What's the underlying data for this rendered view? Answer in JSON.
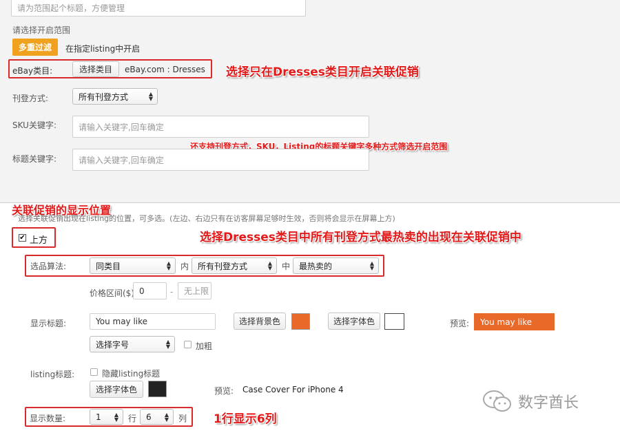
{
  "scope": {
    "title_placeholder": "请为范围起个标题，方便管理",
    "section_label": "请选择开启范围",
    "filter_button": "多重过滤",
    "filter_hint": "在指定listing中开启",
    "ebay_category_label": "eBay类目:",
    "choose_category_button": "选择类目",
    "selected_category": "eBay.com : Dresses",
    "listing_type_label": "刊登方式:",
    "listing_type_value": "所有刊登方式",
    "sku_label": "SKU关键字:",
    "sku_placeholder": "请输入关键字,回车确定",
    "title_keyword_label": "标题关键字:",
    "title_keyword_placeholder": "请输入关键字,回车确定"
  },
  "display": {
    "hint": "选择关联促销出现在listing的位置，可多选。(左边、右边只有在访客屏幕足够时生效，否则将会显示在屏幕上方)",
    "top_option": "上方",
    "algorithm_label": "选品算法:",
    "algorithm_value": "同类目",
    "in_text": "内",
    "listing_type_value": "所有刊登方式",
    "middle_text": "中",
    "sort_value": "最热卖的",
    "price_label": "价格区间($):",
    "price_min": "0",
    "price_sep": "-",
    "price_max_placeholder": "无上限",
    "show_title_label": "显示标题:",
    "show_title_value": "You may like",
    "bg_color_button": "选择背景色",
    "font_color_button": "选择字体色",
    "preview_label": "预览:",
    "preview_text": "You may like",
    "font_size_value": "选择字号",
    "bold_label": "加粗",
    "listing_title_label": "listing标题:",
    "hide_listing_title": "隐藏listing标题",
    "listing_font_color_button": "选择字体色",
    "listing_preview_label": "预览:",
    "listing_preview_text": "Case Cover For iPhone 4",
    "count_label": "显示数量:",
    "rows_value": "1",
    "rows_unit": "行",
    "cols_value": "6",
    "cols_unit": "列"
  },
  "annotations": {
    "a1": "选择只在Dresses类目开启关联促销",
    "a2": "还支持刊登方式，SKU，Listing的标题关键字多种方式筛选开启范围",
    "a3": "关联促销的显示位置",
    "a4": "选择Dresses类目中所有刊登方式最热卖的出现在关联促销中",
    "a5": "1行显示6列"
  },
  "watermark": "数字酋长",
  "colors": {
    "filter_button": "#f0a21e",
    "bg_swatch": "#e8692a",
    "font_swatch": "#ffffff",
    "preview_bg": "#e8692a",
    "listing_font_swatch": "#222222",
    "annotation_red": "#e21a1a"
  }
}
